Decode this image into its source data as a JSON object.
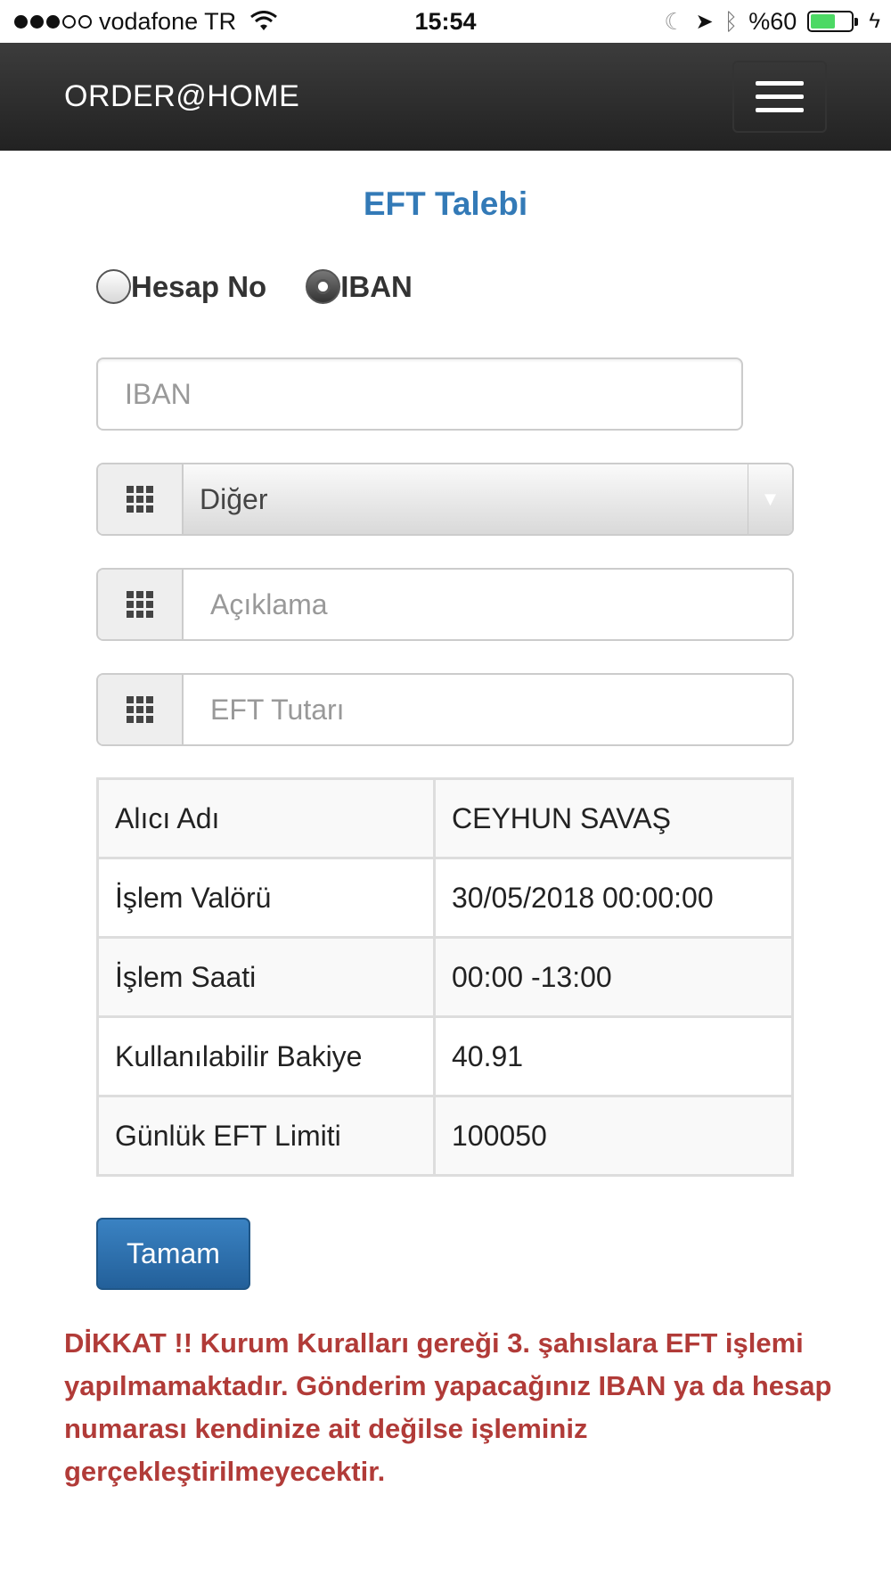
{
  "status_bar": {
    "carrier": "vodafone TR",
    "time": "15:54",
    "battery_text": "%60",
    "battery_level": 0.6,
    "signal_bars_filled": 3,
    "signal_bars_total": 5
  },
  "navbar": {
    "brand": "ORDER@HOME",
    "menu_icon": "hamburger-icon"
  },
  "page": {
    "title": "EFT Talebi"
  },
  "form": {
    "radio_options": [
      {
        "label": "Hesap No",
        "checked": false
      },
      {
        "label": "IBAN",
        "checked": true
      }
    ],
    "iban_placeholder": "IBAN",
    "iban_value": "",
    "bank_select_value": "Diğer",
    "description_placeholder": "Açıklama",
    "amount_placeholder": "EFT Tutarı",
    "addon_icon": "grid-icon"
  },
  "info_table": [
    {
      "label": "Alıcı Adı",
      "value": "CEYHUN SAVAŞ"
    },
    {
      "label": "İşlem Valörü",
      "value": "30/05/2018 00:00:00"
    },
    {
      "label": "İşlem Saati",
      "value": "00:00 -13:00"
    },
    {
      "label": "Kullanılabilir Bakiye",
      "value": "40.91"
    },
    {
      "label": "Günlük EFT Limiti",
      "value": "100050"
    }
  ],
  "submit_label": "Tamam",
  "warning_text": "DİKKAT !! Kurum Kuralları gereği 3. şahıslara EFT işlemi yapılmamaktadır. Gönderim yapacağınız IBAN ya da hesap numarası kendinize ait değilse işleminiz gerçekleştirilmeyecektir.",
  "colors": {
    "title": "#337ab7",
    "warning": "#b13b38",
    "button": "#2f73b3",
    "navbar": "#2a2a2a",
    "battery": "#4cd964"
  }
}
